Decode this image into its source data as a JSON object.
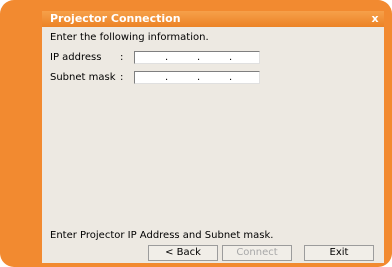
{
  "window": {
    "title": "Projector Connection",
    "close_glyph": "x"
  },
  "form": {
    "instruction": "Enter the following information.",
    "fields": [
      {
        "label": "IP address",
        "colon": ":",
        "value": [
          ".",
          ".",
          "."
        ]
      },
      {
        "label": "Subnet mask",
        "colon": ":",
        "value": [
          ".",
          ".",
          "."
        ]
      }
    ]
  },
  "status": "Enter Projector IP Address and Subnet mask.",
  "buttons": {
    "back": "< Back",
    "connect": "Connect",
    "exit": "Exit"
  },
  "colors": {
    "frame": "#f28a30",
    "titlebar": "#ec8326",
    "panel": "#ede9e2"
  }
}
